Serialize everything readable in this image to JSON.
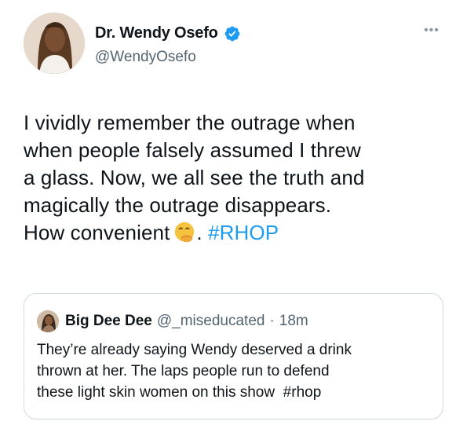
{
  "tweet": {
    "author_name": "Dr. Wendy Osefo",
    "author_handle": "@WendyOsefo",
    "verified": true,
    "more_icon": "more-dots-icon",
    "body_lines": [
      "I vividly remember the outrage when",
      "when people falsely assumed I threw",
      "a glass. Now, we all see the truth and",
      "magically the outrage disappears."
    ],
    "last_line_text": "How convenient",
    "emoji": "face-with-hand-over-mouth-emoji",
    "after_emoji": ".",
    "hashtag": "#RHOP"
  },
  "quoted_tweet": {
    "author_name": "Big Dee Dee",
    "author_handle": "@_miseducated",
    "separator": "·",
    "time": "18m",
    "body_lines": [
      "They’re already saying Wendy deserved a drink",
      "thrown at her. The laps people run to defend"
    ],
    "last_line_text": "these light skin women on this show",
    "hashtag": "#rhop"
  },
  "colors": {
    "text": "#0f1419",
    "secondary": "#536471",
    "link": "#1d9bf0",
    "verified": "#1d9bf0",
    "border": "#cfd9de"
  }
}
